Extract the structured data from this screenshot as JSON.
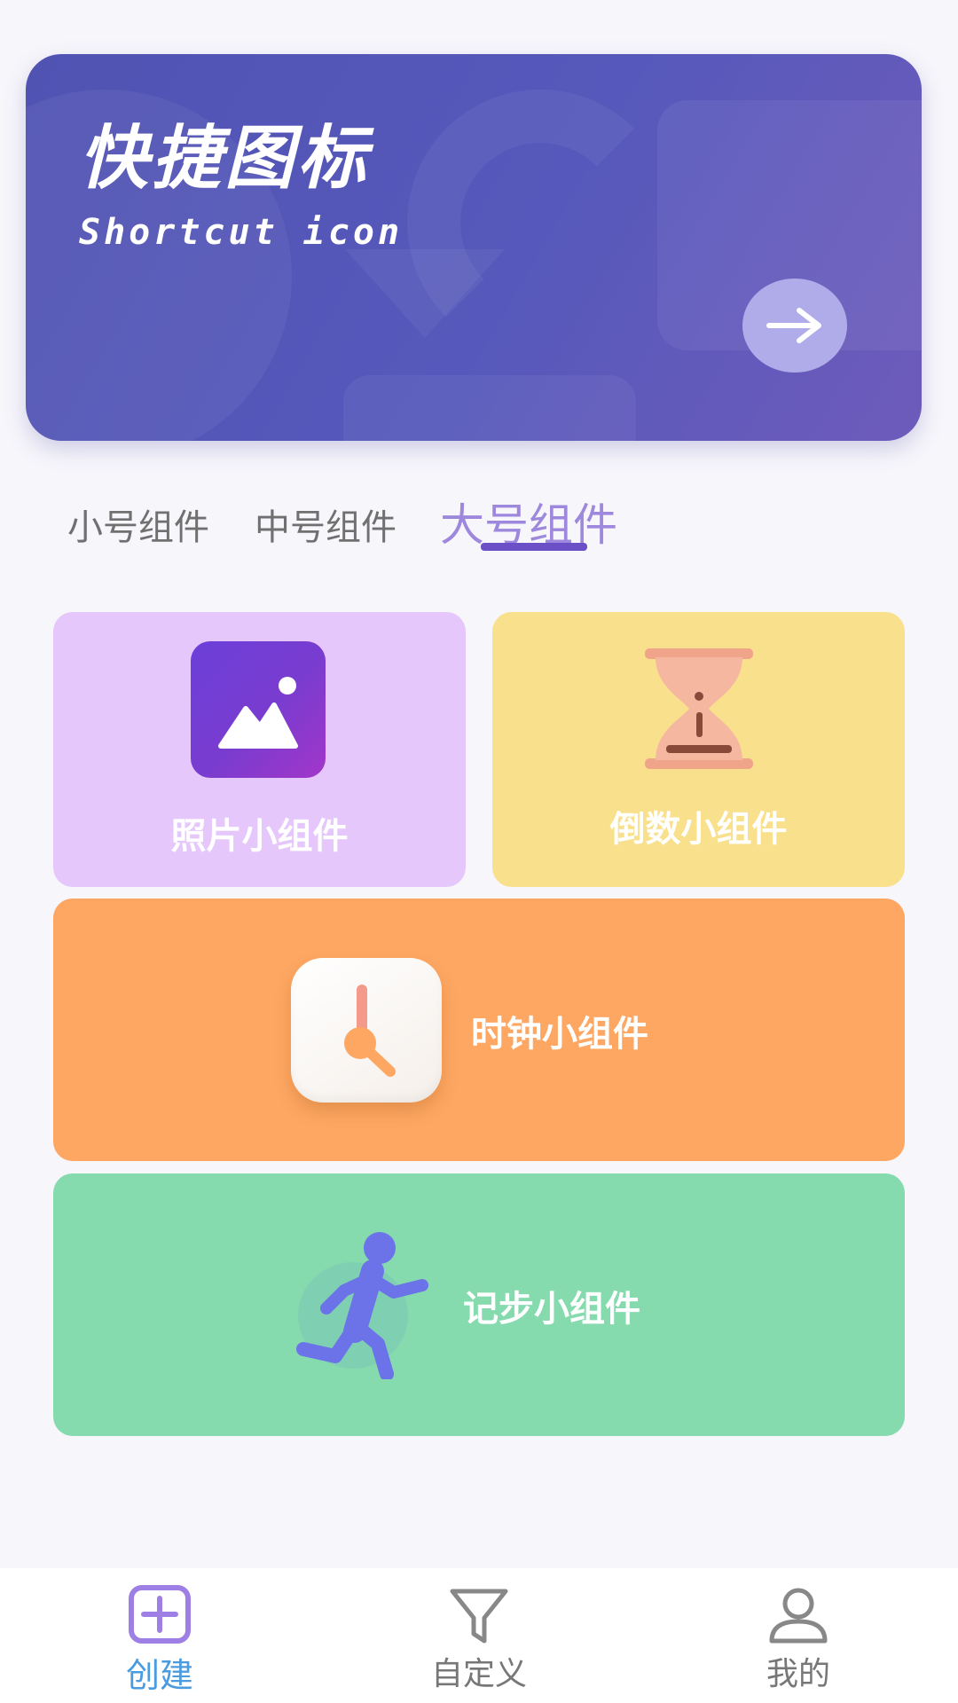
{
  "banner": {
    "title": "快捷图标",
    "subtitle": "Shortcut icon",
    "arrow_icon": "arrow-right-icon"
  },
  "tabs": [
    {
      "label": "小号组件",
      "active": false
    },
    {
      "label": "中号组件",
      "active": false
    },
    {
      "label": "大号组件",
      "active": true
    }
  ],
  "widgets": [
    {
      "label": "照片小组件",
      "icon": "photo-icon",
      "color": "#e6c7fb"
    },
    {
      "label": "倒数小组件",
      "icon": "hourglass-icon",
      "color": "#f9e08c"
    },
    {
      "label": "时钟小组件",
      "icon": "clock-icon",
      "color": "#fda763"
    },
    {
      "label": "记步小组件",
      "icon": "runner-icon",
      "color": "#85dbae"
    }
  ],
  "nav": [
    {
      "label": "创建",
      "icon": "plus-square-icon",
      "active": true
    },
    {
      "label": "自定义",
      "icon": "filter-icon",
      "active": false
    },
    {
      "label": "我的",
      "icon": "user-icon",
      "active": false
    }
  ],
  "colors": {
    "accent": "#6a4fc7",
    "active_tab": "#9d88dd",
    "nav_active": "#4a9be0",
    "banner": "#5458b8"
  }
}
